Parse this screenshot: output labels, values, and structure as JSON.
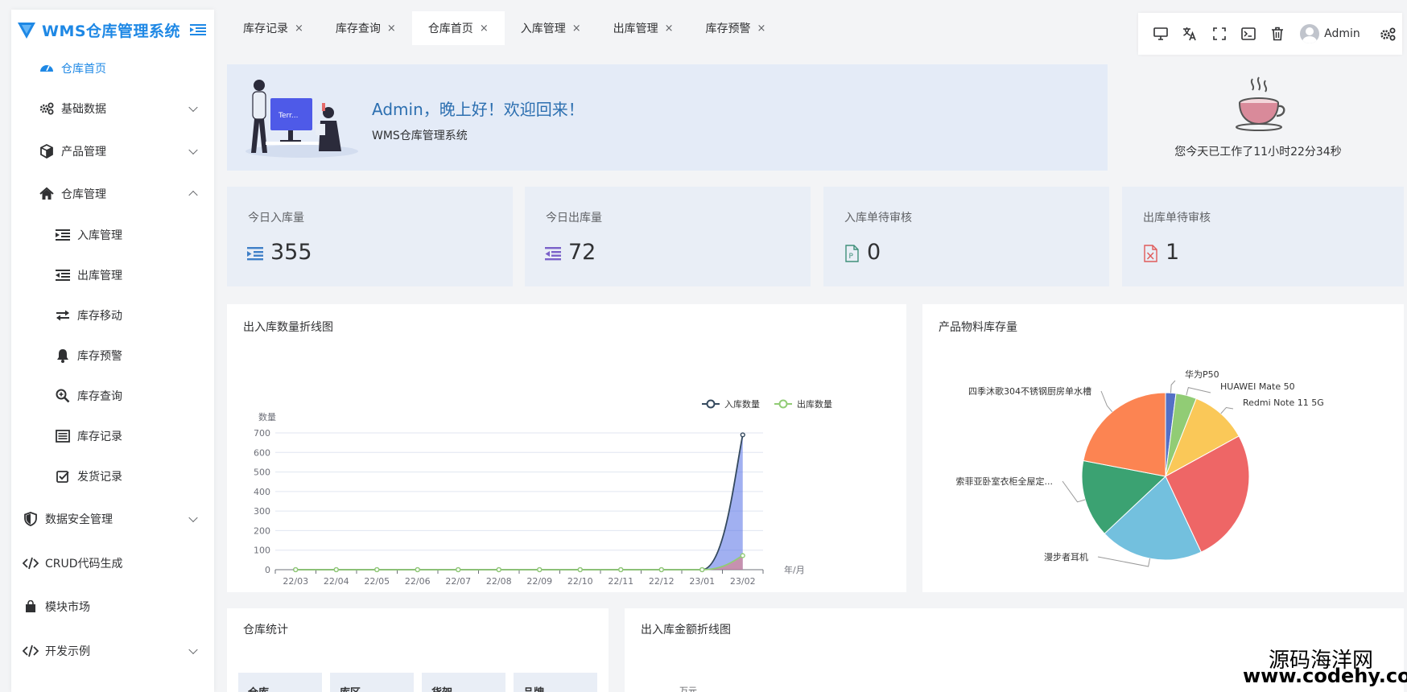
{
  "app": {
    "title": "WMS仓库管理系统"
  },
  "sidebar": {
    "home": "仓库首页",
    "items": [
      {
        "label": "基础数据"
      },
      {
        "label": "产品管理"
      },
      {
        "label": "仓库管理"
      }
    ],
    "sub_items": [
      {
        "label": "入库管理"
      },
      {
        "label": "出库管理"
      },
      {
        "label": "库存移动"
      },
      {
        "label": "库存预警"
      },
      {
        "label": "库存查询"
      },
      {
        "label": "库存记录"
      },
      {
        "label": "发货记录"
      }
    ],
    "bottom_items": [
      {
        "label": "数据安全管理"
      },
      {
        "label": "CRUD代码生成"
      },
      {
        "label": "模块市场"
      },
      {
        "label": "开发示例"
      }
    ]
  },
  "tabs": [
    {
      "label": "库存记录",
      "close": "×"
    },
    {
      "label": "库存查询",
      "close": "×"
    },
    {
      "label": "仓库首页",
      "close": "×"
    },
    {
      "label": "入库管理",
      "close": "×"
    },
    {
      "label": "出库管理",
      "close": "×"
    },
    {
      "label": "库存预警",
      "close": "×"
    }
  ],
  "active_tab": 2,
  "toolbar": {
    "user": "Admin"
  },
  "welcome": {
    "title": "Admin，晚上好！欢迎回来！",
    "subtitle": "WMS仓库管理系统",
    "illu_screen_text": "Terr..."
  },
  "worktime": {
    "text": "您今天已工作了11小时22分34秒"
  },
  "stats": [
    {
      "label": "今日入库量",
      "value": "355",
      "icon": "inbound-icon",
      "color": "#3f7fc7"
    },
    {
      "label": "今日出库量",
      "value": "72",
      "icon": "outbound-icon",
      "color": "#7b61c9"
    },
    {
      "label": "入库单待审核",
      "value": "0",
      "icon": "ppt-file-icon",
      "color": "#3f8f7a"
    },
    {
      "label": "出库单待审核",
      "value": "1",
      "icon": "excel-file-icon",
      "color": "#e05a5a"
    }
  ],
  "line_chart": {
    "title": "出入库数量折线图"
  },
  "pie_chart": {
    "title": "产品物料库存量"
  },
  "bottom": {
    "warehouse_title": "仓库统计",
    "amount_title": "出入库金额折线图",
    "table_headers": [
      "仓库",
      "库区",
      "货架",
      "品牌"
    ],
    "amount_ylabel": "万元"
  },
  "watermark": {
    "line1": "源码海洋网",
    "line2": "www.codehy.com"
  },
  "chart_data": [
    {
      "type": "line",
      "title": "出入库数量折线图",
      "ylabel": "数量",
      "xlabel": "年/月",
      "categories": [
        "22/03",
        "22/04",
        "22/05",
        "22/06",
        "22/07",
        "22/08",
        "22/09",
        "22/10",
        "22/11",
        "22/12",
        "23/01",
        "23/02"
      ],
      "ylim": [
        0,
        700
      ],
      "yticks": [
        0,
        100,
        200,
        300,
        400,
        500,
        600,
        700
      ],
      "legend_position": "top-right",
      "series": [
        {
          "name": "入库数量",
          "color": "#34495e",
          "values": [
            0,
            0,
            0,
            0,
            0,
            0,
            0,
            0,
            0,
            0,
            0,
            690
          ]
        },
        {
          "name": "出库数量",
          "color": "#91cc75",
          "values": [
            0,
            0,
            0,
            0,
            0,
            0,
            0,
            0,
            0,
            0,
            0,
            72
          ]
        }
      ]
    },
    {
      "type": "pie",
      "title": "产品物料库存量",
      "slices": [
        {
          "label": "华为P50",
          "value": 2,
          "color": "#5470c6"
        },
        {
          "label": "HUAWEI Mate 50",
          "value": 4,
          "color": "#91cc75"
        },
        {
          "label": "Redmi Note 11 5G",
          "value": 11,
          "color": "#fac858"
        },
        {
          "label": "",
          "value": 26,
          "color": "#ee6666"
        },
        {
          "label": "漫步者耳机",
          "value": 20,
          "color": "#73c0de"
        },
        {
          "label": "索菲亚卧室衣柜全屋定...",
          "value": 15,
          "color": "#3ba272"
        },
        {
          "label": "四季沐歌304不锈钢厨房单水槽",
          "value": 22,
          "color": "#fc8452"
        }
      ]
    }
  ]
}
